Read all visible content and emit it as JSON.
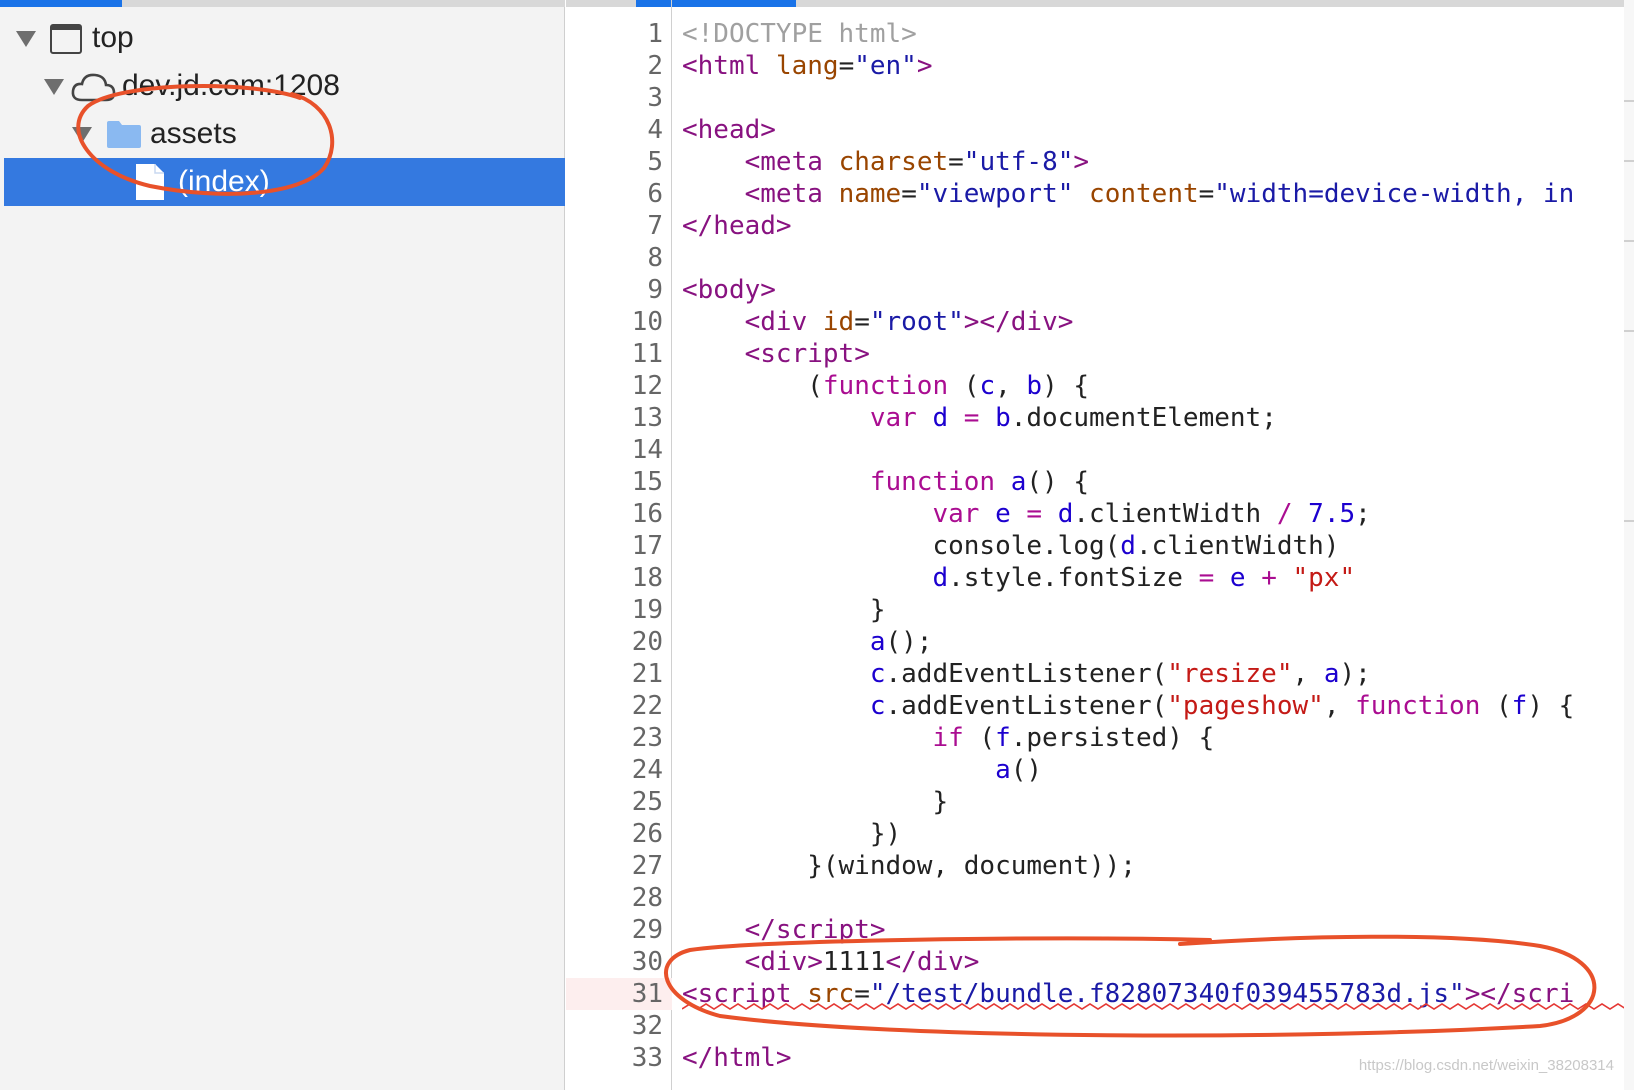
{
  "tree": {
    "top_label": "top",
    "domain_label": "dev.jd.com:1208",
    "folder_label": "assets",
    "file_label": "(index)"
  },
  "code": {
    "lines": [
      {
        "n": "1",
        "html": "<span style=\"color:#a0a0a0\">&lt;!DOCTYPE html&gt;</span>"
      },
      {
        "n": "2",
        "html": "<span style=\"color:#881280\">&lt;html</span> <span style=\"color:#994500\">lang</span>=<span style=\"color:#1a1aa6\">\"en\"</span><span style=\"color:#881280\">&gt;</span>"
      },
      {
        "n": "3",
        "html": ""
      },
      {
        "n": "4",
        "html": "<span style=\"color:#881280\">&lt;head&gt;</span>"
      },
      {
        "n": "5",
        "html": "    <span style=\"color:#881280\">&lt;meta</span> <span style=\"color:#994500\">charset</span>=<span style=\"color:#1a1aa6\">\"utf-8\"</span><span style=\"color:#881280\">&gt;</span>"
      },
      {
        "n": "6",
        "html": "    <span style=\"color:#881280\">&lt;meta</span> <span style=\"color:#994500\">name</span>=<span style=\"color:#1a1aa6\">\"viewport\"</span> <span style=\"color:#994500\">content</span>=<span style=\"color:#1a1aa6\">\"width=device-width, in</span>"
      },
      {
        "n": "7",
        "html": "<span style=\"color:#881280\">&lt;/head&gt;</span>"
      },
      {
        "n": "8",
        "html": ""
      },
      {
        "n": "9",
        "html": "<span style=\"color:#881280\">&lt;body&gt;</span>"
      },
      {
        "n": "10",
        "html": "    <span style=\"color:#881280\">&lt;div</span> <span style=\"color:#994500\">id</span>=<span style=\"color:#1a1aa6\">\"root\"</span><span style=\"color:#881280\">&gt;&lt;/div&gt;</span>"
      },
      {
        "n": "11",
        "html": "    <span style=\"color:#881280\">&lt;script&gt;</span>"
      },
      {
        "n": "12",
        "html": "        (<span style=\"color:#aa0d91\">function</span> (<span style=\"color:#1c00cf\">c</span>, <span style=\"color:#1c00cf\">b</span>) {"
      },
      {
        "n": "13",
        "html": "            <span style=\"color:#aa0d91\">var</span> <span style=\"color:#1c00cf\">d</span> <span style=\"color:#aa0d91\">=</span> <span style=\"color:#1c00cf\">b</span>.documentElement;"
      },
      {
        "n": "14",
        "html": ""
      },
      {
        "n": "15",
        "html": "            <span style=\"color:#aa0d91\">function</span> <span style=\"color:#1c00cf\">a</span>() {"
      },
      {
        "n": "16",
        "html": "                <span style=\"color:#aa0d91\">var</span> <span style=\"color:#1c00cf\">e</span> <span style=\"color:#aa0d91\">=</span> <span style=\"color:#1c00cf\">d</span>.clientWidth <span style=\"color:#aa0d91\">/</span> <span style=\"color:#1c00cf\">7.5</span>;"
      },
      {
        "n": "17",
        "html": "                console.log(<span style=\"color:#1c00cf\">d</span>.clientWidth)"
      },
      {
        "n": "18",
        "html": "                <span style=\"color:#1c00cf\">d</span>.style.fontSize <span style=\"color:#aa0d91\">=</span> <span style=\"color:#1c00cf\">e</span> <span style=\"color:#aa0d91\">+</span> <span style=\"color:#c41a16\">\"px\"</span>"
      },
      {
        "n": "19",
        "html": "            }"
      },
      {
        "n": "20",
        "html": "            <span style=\"color:#1c00cf\">a</span>();"
      },
      {
        "n": "21",
        "html": "            <span style=\"color:#1c00cf\">c</span>.addEventListener(<span style=\"color:#c41a16\">\"resize\"</span>, <span style=\"color:#1c00cf\">a</span>);"
      },
      {
        "n": "22",
        "html": "            <span style=\"color:#1c00cf\">c</span>.addEventListener(<span style=\"color:#c41a16\">\"pageshow\"</span>, <span style=\"color:#aa0d91\">function</span> (<span style=\"color:#1c00cf\">f</span>) {"
      },
      {
        "n": "23",
        "html": "                <span style=\"color:#aa0d91\">if</span> (<span style=\"color:#1c00cf\">f</span>.persisted) {"
      },
      {
        "n": "24",
        "html": "                    <span style=\"color:#1c00cf\">a</span>()"
      },
      {
        "n": "25",
        "html": "                }"
      },
      {
        "n": "26",
        "html": "            })"
      },
      {
        "n": "27",
        "html": "        }(window, document));"
      },
      {
        "n": "28",
        "html": ""
      },
      {
        "n": "29",
        "html": "    <span style=\"color:#881280\">&lt;/script&gt;</span>"
      },
      {
        "n": "30",
        "html": "    <span style=\"color:#881280\">&lt;div&gt;</span>1111<span style=\"color:#881280\">&lt;/div&gt;</span>"
      },
      {
        "n": "31",
        "html": "<span style=\"color:#881280\">&lt;script</span> <span style=\"color:#994500\">src</span>=<span style=\"color:#1a1aa6\">\"/test/bundle.f82807340f039455783d.js\"</span><span style=\"color:#881280\">&gt;&lt;/scri</span>"
      },
      {
        "n": "32",
        "html": ""
      },
      {
        "n": "33",
        "html": "<span style=\"color:#881280\">&lt;/html&gt;</span>"
      }
    ]
  },
  "watermark": "https://blog.csdn.net/weixin_38208314",
  "colors": {
    "selected_row": "#3479e0",
    "tag": "#881280",
    "attr": "#994500",
    "string": "#1a1aa6",
    "keyword": "#aa0d91",
    "ident": "#1c00cf",
    "annotation": "#e8512a"
  }
}
